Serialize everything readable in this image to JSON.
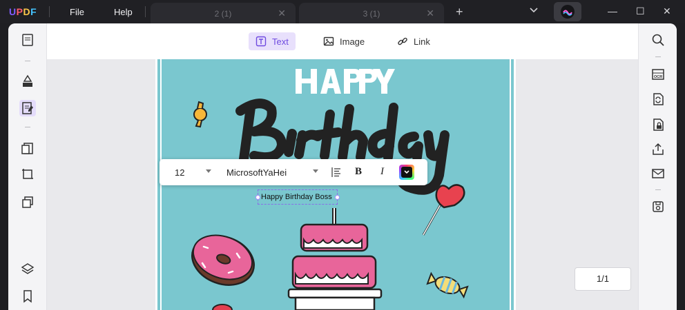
{
  "titlebar": {
    "logo": "UPDF",
    "menu": [
      "File",
      "Help"
    ],
    "tabs": [
      {
        "label": "2 (1)"
      },
      {
        "label": "3 (1)"
      }
    ],
    "new_tab": "+",
    "window": {
      "minimize": "—",
      "maximize": "☐",
      "close": "✕"
    }
  },
  "edit_toolbar": {
    "text_label": "Text",
    "image_label": "Image",
    "link_label": "Link"
  },
  "format_bar": {
    "font_size": "12",
    "font_family": "MicrosoftYaHei",
    "bold": "B",
    "italic": "I",
    "color": "#111111"
  },
  "document": {
    "selected_text": "Happy Birthday Boss",
    "background_color": "#7ac7cf"
  },
  "page_indicator": "1/1",
  "colors": {
    "accent": "#8a6ce8",
    "active_bg": "#e8e0fc"
  }
}
